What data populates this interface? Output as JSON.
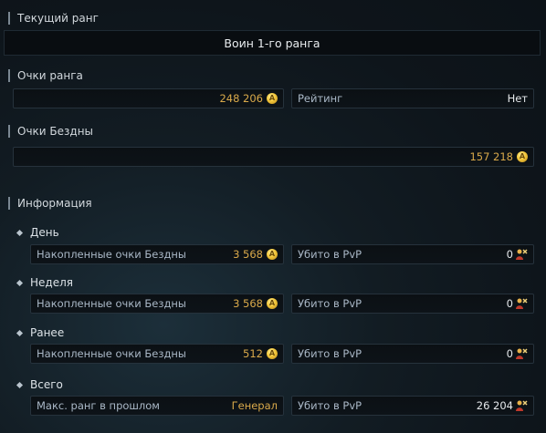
{
  "current_rank": {
    "title": "Текущий ранг",
    "value": "Воин 1-го ранга"
  },
  "rank_points": {
    "title": "Очки ранга",
    "value": "248 206",
    "rating_label": "Рейтинг",
    "rating_value": "Нет"
  },
  "abyss_points": {
    "title": "Очки Бездны",
    "value": "157 218"
  },
  "info": {
    "title": "Информация",
    "periods": [
      {
        "name": "День",
        "left_label": "Накопленные очки Бездны",
        "left_value": "3 568",
        "right_label": "Убито в PvP",
        "right_value": "0"
      },
      {
        "name": "Неделя",
        "left_label": "Накопленные очки Бездны",
        "left_value": "3 568",
        "right_label": "Убито в PvP",
        "right_value": "0"
      },
      {
        "name": "Ранее",
        "left_label": "Накопленные очки Бездны",
        "left_value": "512",
        "right_label": "Убито в PvP",
        "right_value": "0"
      },
      {
        "name": "Всего",
        "left_label": "Макс. ранг в прошлом",
        "left_value": "Генерал",
        "right_label": "Убито в PvP",
        "right_value": "26 204"
      }
    ]
  },
  "icons": {
    "coin": "abyss-coin-icon",
    "pvp": "pvp-kill-icon"
  },
  "colors": {
    "gold": "#d9a94a",
    "label": "#aab8c7",
    "background": "#121c23"
  }
}
